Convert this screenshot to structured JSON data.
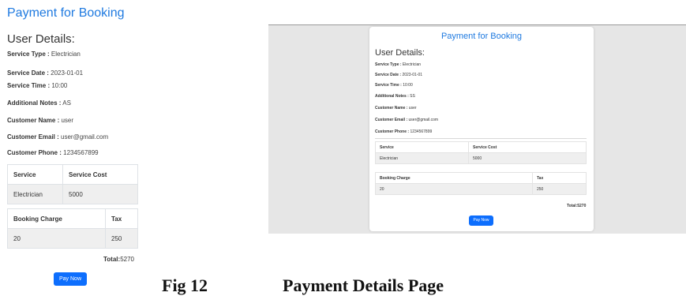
{
  "mobile": {
    "title": "Payment for Booking",
    "user_details_heading": "User Details:",
    "fields": [
      {
        "label": "Service Type :",
        "value": " Electrician"
      },
      {
        "label": "Service Date :",
        "value": " 2023-01-01"
      },
      {
        "label": "Service Time :",
        "value": " 10:00"
      },
      {
        "label": "Additional Notes :",
        "value": " AS"
      },
      {
        "label": "Customer Name :",
        "value": " user"
      },
      {
        "label": "Customer Email :",
        "value": " user@gmail.com"
      },
      {
        "label": "Customer Phone :",
        "value": " 1234567899"
      }
    ],
    "service_table": {
      "headers": [
        "Service",
        "Service Cost"
      ],
      "rows": [
        [
          "Electrician",
          "5000"
        ]
      ]
    },
    "charge_table": {
      "headers": [
        "Booking Charge",
        "Tax"
      ],
      "rows": [
        [
          "20",
          "250"
        ]
      ]
    },
    "total_label": "Total:",
    "total_value": "5270",
    "pay_button": "Pay Now"
  },
  "desktop": {
    "title": "Payment for Booking",
    "user_details_heading": "User Details:",
    "fields": [
      {
        "label": "Service Type :",
        "value": " Electrician"
      },
      {
        "label": "Service Date :",
        "value": " 2023-01-01"
      },
      {
        "label": "Service Time :",
        "value": " 10:00"
      },
      {
        "label": "Additional Notes :",
        "value": " SS"
      },
      {
        "label": "Customer Name :",
        "value": " user"
      },
      {
        "label": "Customer Email :",
        "value": " user@gmail.com"
      },
      {
        "label": "Customer Phone :",
        "value": " 1234567899"
      }
    ],
    "service_table": {
      "headers": [
        "Service",
        "Service Cost"
      ],
      "rows": [
        [
          "Electrician",
          "5000"
        ]
      ]
    },
    "charge_table": {
      "headers": [
        "Booking Charge",
        "Tax"
      ],
      "rows": [
        [
          "20",
          "250"
        ]
      ]
    },
    "total_label": "Total:",
    "total_value": "5270",
    "pay_button": "Pay Now"
  },
  "caption": {
    "number": "Fig 12",
    "text": "Payment Details Page"
  },
  "colors": {
    "title_blue": "#1f7ae0",
    "button_blue": "#0d6efd",
    "table_cell_bg": "#efefef",
    "desktop_bg": "#e6e6e6"
  }
}
